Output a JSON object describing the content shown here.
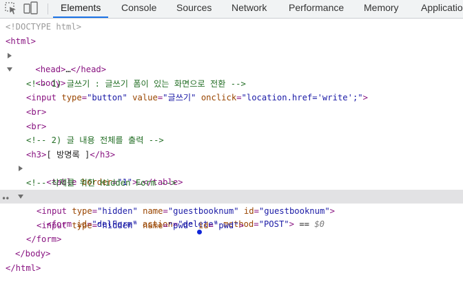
{
  "toolbar": {
    "tabs": [
      {
        "label": "Elements"
      },
      {
        "label": "Console"
      },
      {
        "label": "Sources"
      },
      {
        "label": "Network"
      },
      {
        "label": "Performance"
      },
      {
        "label": "Memory"
      },
      {
        "label": "Applicatio"
      }
    ],
    "active_tab": "Elements",
    "accent_color": "#1a73e8"
  },
  "dom": {
    "doctype": "<!DOCTYPE html>",
    "html_open": "<html>",
    "head_open": "<head>",
    "ellipsis": "…",
    "head_close": "</head>",
    "body_open": "<body>",
    "comment1": "<!-- 1) 글쓰기 : 글쓰기 폼이 있는 화면으로 전환 -->",
    "input1": {
      "open": "<input",
      "a1": "type",
      "v1": "\"button\"",
      "a2": "value",
      "v2": "\"글쓰기\"",
      "a3": "onclick",
      "v3": "\"location.href='write';\"",
      "close": ">"
    },
    "br": "<br>",
    "comment2": "<!-- 2) 글 내용 전체를 출력 -->",
    "h3": {
      "open": "<h3>",
      "text": "[ 방명록 ]",
      "close": "</h3>"
    },
    "table": {
      "open": "<table",
      "a1": "border",
      "v1": "\"1\"",
      "close": ">",
      "end": "</table>"
    },
    "comment3": "<!-- 삭제를 위한 Hidden Form -->",
    "form": {
      "open": "<form",
      "a1": "id",
      "v1": "\"delForm\"",
      "a2": "action",
      "v2": "\"delete\"",
      "a3": "method",
      "v3": "\"POST\"",
      "close": ">",
      "eq": " == ",
      "dollar": "$0"
    },
    "input2": {
      "open": "<input",
      "a1": "type",
      "v1": "\"hidden\"",
      "a2": "name",
      "v2": "\"guestbooknum\"",
      "a3": "id",
      "v3": "\"guestbooknum\"",
      "close": ">"
    },
    "input3": {
      "open": "<input",
      "a1": "type",
      "v1": "\"hidden\"",
      "a2": "name",
      "v2": "\"pwd\"",
      "a3": "id",
      "v3": "\"pwd\"",
      "close": ">"
    },
    "form_close": "</form>",
    "body_close": "</body>",
    "html_close": "</html>",
    "selected_dots": "••"
  }
}
